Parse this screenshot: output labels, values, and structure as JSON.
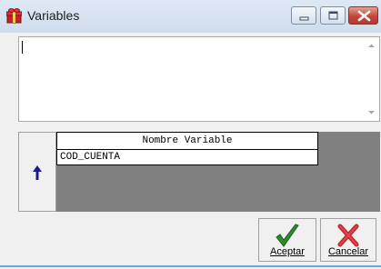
{
  "window": {
    "title": "Variables",
    "icon": "app-gift-icon",
    "controls": [
      "minimize-icon",
      "maximize-icon",
      "close-icon"
    ]
  },
  "editor": {
    "value": ""
  },
  "grid": {
    "column_header": "Nombre Variable",
    "rows": [
      "COD_CUENTA"
    ]
  },
  "buttons": {
    "up_icon": "arrow-up-icon",
    "accept_label": "Aceptar",
    "accept_icon": "checkmark-icon",
    "cancel_label": "Cancelar",
    "cancel_icon": "x-icon"
  },
  "colors": {
    "grid_background": "#808080",
    "accept_green": "#2e8b2e",
    "cancel_red": "#c0262b",
    "up_arrow": "#1b1b8a"
  }
}
